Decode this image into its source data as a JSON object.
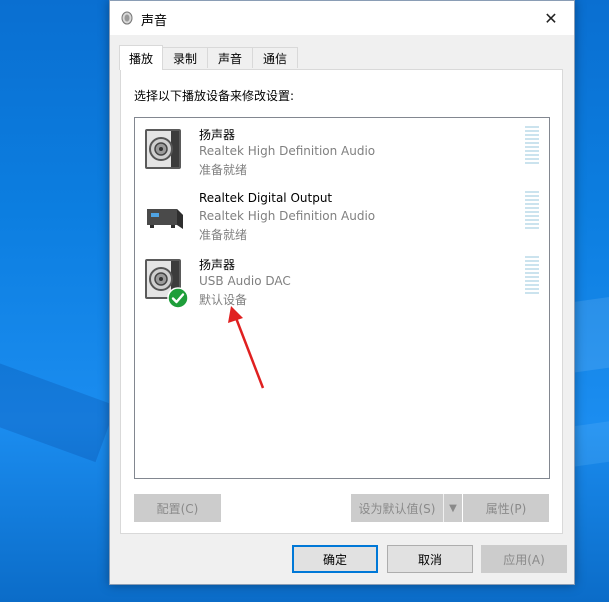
{
  "window": {
    "title": "声音",
    "close_glyph": "✕"
  },
  "tabs": [
    {
      "label": "播放",
      "active": true
    },
    {
      "label": "录制",
      "active": false
    },
    {
      "label": "声音",
      "active": false
    },
    {
      "label": "通信",
      "active": false
    }
  ],
  "panel": {
    "instruction": "选择以下播放设备来修改设置:"
  },
  "devices": [
    {
      "name": "扬声器",
      "description": "Realtek High Definition Audio",
      "status": "准备就绪",
      "icon": "speaker-icon",
      "default": false
    },
    {
      "name": "Realtek Digital Output",
      "description": "Realtek High Definition Audio",
      "status": "准备就绪",
      "icon": "digital-output-icon",
      "default": false
    },
    {
      "name": "扬声器",
      "description": "USB Audio DAC",
      "status": "默认设备",
      "icon": "speaker-icon",
      "default": true
    }
  ],
  "panel_buttons": {
    "configure": "配置(C)",
    "set_default": "设为默认值(S)",
    "properties": "属性(P)"
  },
  "footer_buttons": {
    "ok": "确定",
    "cancel": "取消",
    "apply": "应用(A)"
  },
  "colors": {
    "accent": "#0078d7",
    "check_green": "#1e9e3a",
    "annotation_arrow": "#e02020",
    "desktop_blue": "#0c7ee0"
  }
}
